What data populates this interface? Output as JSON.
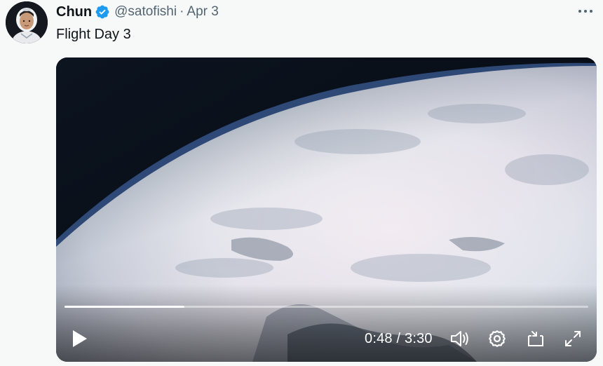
{
  "tweet": {
    "author": {
      "display_name": "Chun",
      "handle": "@satofishi",
      "verified": true,
      "avatar_icon": "astronaut-avatar"
    },
    "separator": "·",
    "date": "Apr 3",
    "text": "Flight Day 3",
    "more_icon": "more-horizontal-icon"
  },
  "media": {
    "type": "video",
    "description_icon": "earth-from-orbit",
    "player": {
      "current_time": "0:48",
      "duration": "3:30",
      "time_display": "0:48 / 3:30",
      "progress_fraction": 0.229,
      "icons": [
        "play-icon",
        "volume-icon",
        "settings-icon",
        "picture-in-picture-icon",
        "fullscreen-icon"
      ]
    }
  },
  "colors": {
    "verified_blue": "#1d9bf0",
    "text_primary": "#0f1419",
    "text_secondary": "#536471",
    "background": "#f7f9f9"
  }
}
